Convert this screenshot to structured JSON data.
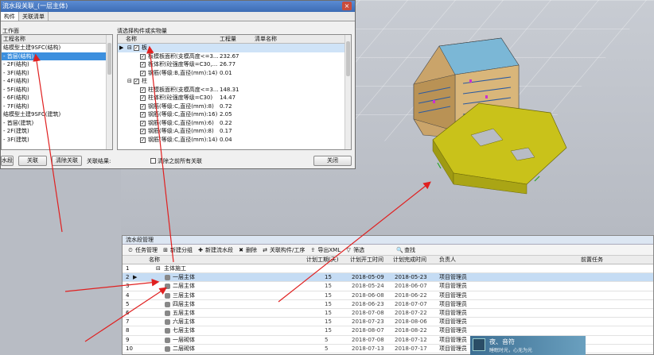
{
  "dialog": {
    "title": "流水段关联_(一层主体)",
    "close_glyph": "×",
    "tabs": [
      "构件",
      "关联清单"
    ],
    "left_label": "工作面",
    "left_header": "工程名称",
    "tree": [
      {
        "text": "结模型土建9SFC(结构)",
        "sel": false
      },
      {
        "text": "- 首层(结构)",
        "sel": true
      },
      {
        "text": "- 2F(结构)",
        "sel": false
      },
      {
        "text": "- 3F(结构)",
        "sel": false
      },
      {
        "text": "- 4F(结构)",
        "sel": false
      },
      {
        "text": "- 5F(结构)",
        "sel": false
      },
      {
        "text": "- 6F(结构)",
        "sel": false
      },
      {
        "text": "- 7F(结构)",
        "sel": false
      },
      {
        "text": "结模型土建9SFC(建筑)",
        "sel": false
      },
      {
        "text": "- 首层(建筑)",
        "sel": false
      },
      {
        "text": "- 2F(建筑)",
        "sel": false
      },
      {
        "text": "- 3F(建筑)",
        "sel": false
      }
    ],
    "right_label": "请选择构件或实物量",
    "grid_headers": {
      "name": "名称",
      "qty": "工程量",
      "list": "清单名称"
    },
    "items": [
      {
        "text": "板",
        "qty": "",
        "group": true,
        "sel": true,
        "expander": "⊟"
      },
      {
        "text": "板模板面积(支模高度<=3...",
        "qty": "232.67",
        "group": false,
        "sel": false,
        "expander": ""
      },
      {
        "text": "板体积(砼强度等级=C30,...",
        "qty": "26.77",
        "group": false,
        "sel": false,
        "expander": ""
      },
      {
        "text": "钢筋(等级:B,直径(mm):14)",
        "qty": "0.01",
        "group": false,
        "sel": false,
        "expander": ""
      },
      {
        "text": "柱",
        "qty": "",
        "group": true,
        "sel": false,
        "expander": "⊟"
      },
      {
        "text": "柱模板面积(支模高度<=3...",
        "qty": "148.31",
        "group": false,
        "sel": false,
        "expander": ""
      },
      {
        "text": "柱体积(砼强度等级=C30)",
        "qty": "14.47",
        "group": false,
        "sel": false,
        "expander": ""
      },
      {
        "text": "钢筋(等级:C,直径(mm):8)",
        "qty": "0.72",
        "group": false,
        "sel": false,
        "expander": ""
      },
      {
        "text": "钢筋(等级:C,直径(mm):16)",
        "qty": "2.05",
        "group": false,
        "sel": false,
        "expander": ""
      },
      {
        "text": "钢筋(等级:C,直径(mm):6)",
        "qty": "0.22",
        "group": false,
        "sel": false,
        "expander": ""
      },
      {
        "text": "钢筋(等级:A,直径(mm):8)",
        "qty": "0.17",
        "group": false,
        "sel": false,
        "expander": ""
      },
      {
        "text": "钢筋(等级:C,直径(mm):14)",
        "qty": "0.04",
        "group": false,
        "sel": false,
        "expander": ""
      }
    ],
    "buttons": {
      "left_partial": "水段",
      "link": "关联",
      "clear": "清除关联",
      "result_label": "关联结果:",
      "clear_all": "清除之前所有关联",
      "close": "关闭"
    }
  },
  "flow_panel": {
    "title": "流水段管理",
    "toolbar": [
      {
        "icon": "⏲",
        "label": "任务管理"
      },
      {
        "icon": "⊞",
        "label": "新建分组"
      },
      {
        "icon": "✚",
        "label": "新建流水段"
      },
      {
        "icon": "✖",
        "label": "删除"
      },
      {
        "icon": "⇄",
        "label": "关联构件/工序"
      },
      {
        "icon": "⇪",
        "label": "导出XML"
      },
      {
        "icon": "▽",
        "label": "筛选"
      },
      {
        "icon": "🔍",
        "label": "查找"
      }
    ],
    "headers": {
      "name": "名称",
      "days": "计划工期(天)",
      "start": "计划开工时间",
      "end": "计划完成时间",
      "owner": "负责人",
      "task": "前置任务"
    },
    "rows": [
      {
        "n": "1",
        "name": "主体施工",
        "days": "",
        "start": "",
        "end": "",
        "owner": "",
        "group": true,
        "sel": false
      },
      {
        "n": "2",
        "name": "一层主体",
        "days": "15",
        "start": "2018-05-09",
        "end": "2018-05-23",
        "owner": "项目管理员",
        "group": false,
        "sel": true
      },
      {
        "n": "3",
        "name": "二层主体",
        "days": "15",
        "start": "2018-05-24",
        "end": "2018-06-07",
        "owner": "项目管理员",
        "group": false,
        "sel": false
      },
      {
        "n": "4",
        "name": "三层主体",
        "days": "15",
        "start": "2018-06-08",
        "end": "2018-06-22",
        "owner": "项目管理员",
        "group": false,
        "sel": false
      },
      {
        "n": "5",
        "name": "四层主体",
        "days": "15",
        "start": "2018-06-23",
        "end": "2018-07-07",
        "owner": "项目管理员",
        "group": false,
        "sel": false
      },
      {
        "n": "6",
        "name": "五层主体",
        "days": "15",
        "start": "2018-07-08",
        "end": "2018-07-22",
        "owner": "项目管理员",
        "group": false,
        "sel": false
      },
      {
        "n": "7",
        "name": "六层主体",
        "days": "15",
        "start": "2018-07-23",
        "end": "2018-08-06",
        "owner": "项目管理员",
        "group": false,
        "sel": false
      },
      {
        "n": "8",
        "name": "七层主体",
        "days": "15",
        "start": "2018-08-07",
        "end": "2018-08-22",
        "owner": "项目管理员",
        "group": false,
        "sel": false
      },
      {
        "n": "9",
        "name": "一层砌体",
        "days": "5",
        "start": "2018-07-08",
        "end": "2018-07-12",
        "owner": "项目管理员",
        "group": false,
        "sel": false
      },
      {
        "n": "10",
        "name": "二层砌体",
        "days": "5",
        "start": "2018-07-13",
        "end": "2018-07-17",
        "owner": "项目管理员",
        "group": false,
        "sel": false
      }
    ]
  },
  "notification": {
    "title": "夜、音符",
    "line2": "睡眠时光，心无为光"
  },
  "colors": {
    "accent": "#3c8fde",
    "arrow": "#e02020",
    "building_yellow": "#c9c21a"
  }
}
